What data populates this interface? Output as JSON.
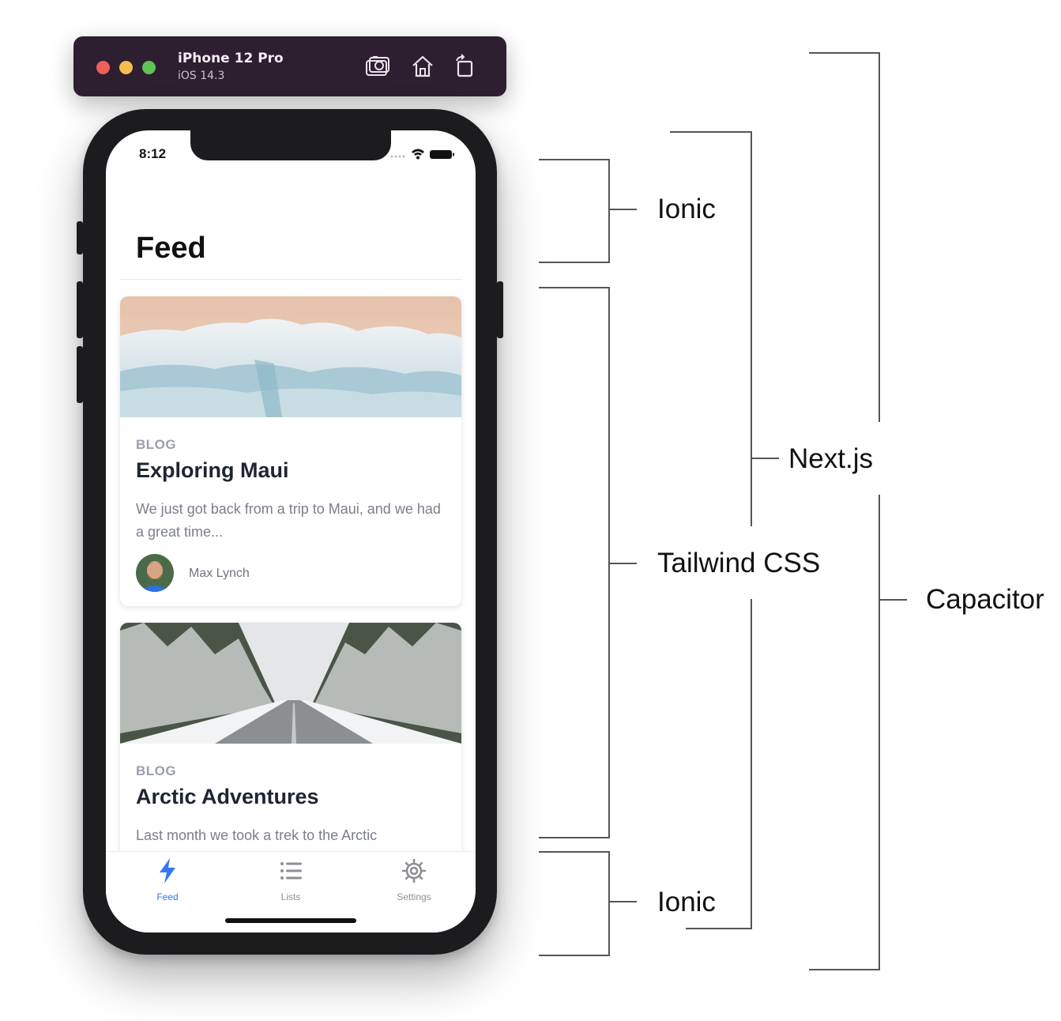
{
  "simulator": {
    "device_name": "iPhone 12 Pro",
    "os_version": "iOS 14.3",
    "icons": [
      "screenshot-icon",
      "home-icon",
      "rotate-icon"
    ]
  },
  "status_bar": {
    "time": "8:12"
  },
  "page": {
    "title": "Feed"
  },
  "cards": [
    {
      "eyebrow": "BLOG",
      "title": "Exploring Maui",
      "text": "We just got back from a trip to Maui, and we had a great time...",
      "author": "Max Lynch"
    },
    {
      "eyebrow": "BLOG",
      "title": "Arctic Adventures",
      "text": "Last month we took a trek to the Arctic"
    }
  ],
  "tabs": [
    {
      "label": "Feed",
      "icon": "flash-icon",
      "active": true
    },
    {
      "label": "Lists",
      "icon": "list-icon",
      "active": false
    },
    {
      "label": "Settings",
      "icon": "cog-icon",
      "active": false
    }
  ],
  "annotations": {
    "ionic_top": "Ionic",
    "tailwind": "Tailwind CSS",
    "ionic_bottom": "Ionic",
    "nextjs": "Next.js",
    "capacitor": "Capacitor"
  },
  "colors": {
    "accent": "#3478f6",
    "simulator_bar": "#2e1f30",
    "phone_frame": "#1c1c1e",
    "inactive_tab": "#8e8e93"
  }
}
